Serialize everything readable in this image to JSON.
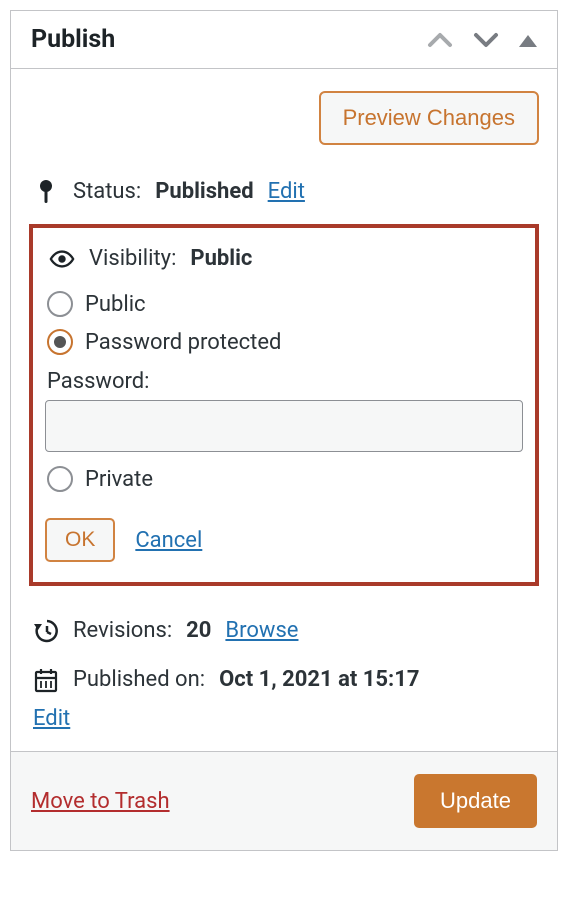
{
  "panel": {
    "title": "Publish"
  },
  "buttons": {
    "preview": "Preview Changes",
    "ok": "OK",
    "cancel": "Cancel",
    "update": "Update"
  },
  "status": {
    "label": "Status:",
    "value": "Published",
    "edit": "Edit"
  },
  "visibility": {
    "label": "Visibility:",
    "value": "Public",
    "options": {
      "public": "Public",
      "password": "Password protected",
      "private": "Private"
    },
    "password_label": "Password:",
    "password_value": ""
  },
  "revisions": {
    "label": "Revisions:",
    "count": "20",
    "browse": "Browse"
  },
  "published": {
    "label": "Published on:",
    "value": "Oct 1, 2021 at 15:17",
    "edit": "Edit"
  },
  "footer": {
    "trash": "Move to Trash"
  }
}
